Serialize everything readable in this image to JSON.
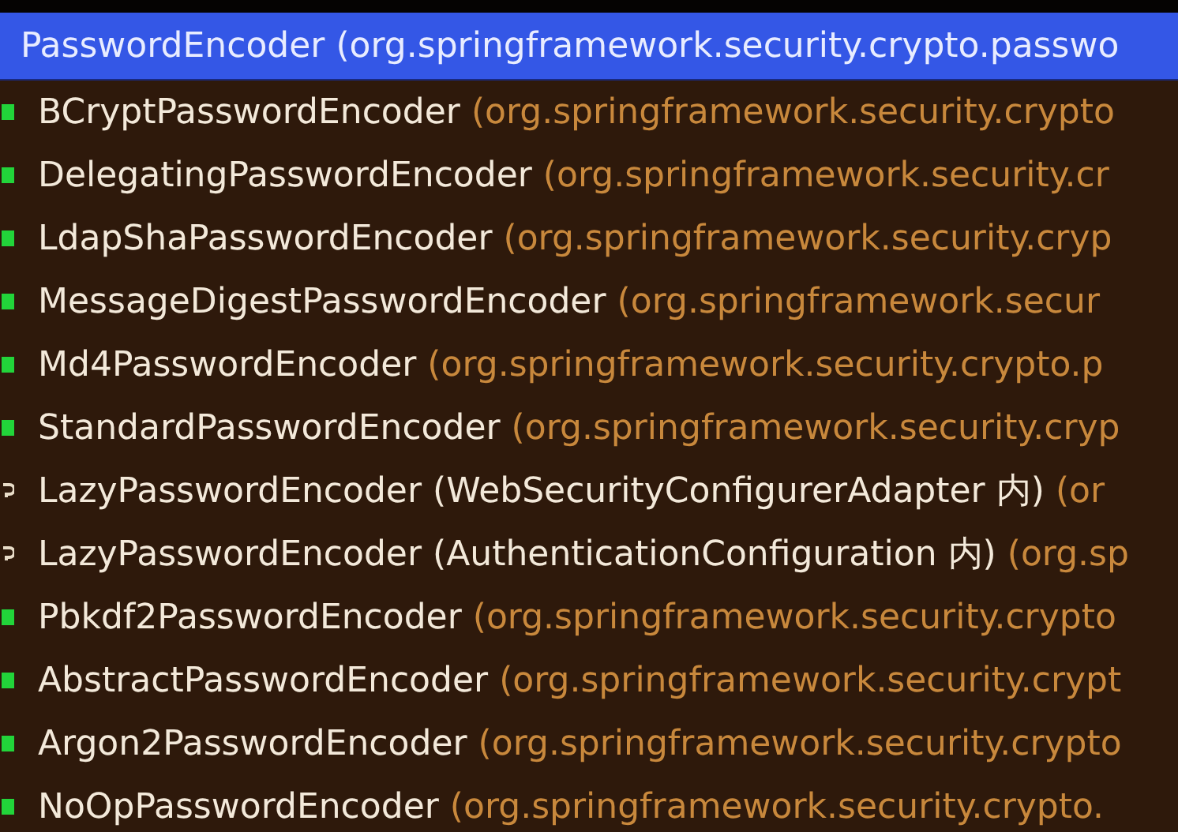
{
  "header": {
    "name": "PasswordEncoder",
    "detail": "(org.springframework.security.crypto.passwo"
  },
  "items": [
    {
      "kind": "class",
      "name": "BCryptPasswordEncoder",
      "detail": "(org.springframework.security.crypto"
    },
    {
      "kind": "class",
      "name": "DelegatingPasswordEncoder",
      "detail": "(org.springframework.security.cr"
    },
    {
      "kind": "class",
      "name": "LdapShaPasswordEncoder",
      "detail": "(org.springframework.security.cryp"
    },
    {
      "kind": "class",
      "name": "MessageDigestPasswordEncoder",
      "detail": "(org.springframework.secur"
    },
    {
      "kind": "class",
      "name": "Md4PasswordEncoder",
      "detail": "(org.springframework.security.crypto.p"
    },
    {
      "kind": "class",
      "name": "StandardPasswordEncoder",
      "detail": "(org.springframework.security.cryp"
    },
    {
      "kind": "inner",
      "name": "LazyPasswordEncoder",
      "outer": "(WebSecurityConfigurerAdapter 内)",
      "detail": "(or"
    },
    {
      "kind": "inner",
      "name": "LazyPasswordEncoder",
      "outer": "(AuthenticationConfiguration 内)",
      "detail": "(org.sp"
    },
    {
      "kind": "class",
      "name": "Pbkdf2PasswordEncoder",
      "detail": "(org.springframework.security.crypto"
    },
    {
      "kind": "class",
      "name": "AbstractPasswordEncoder",
      "detail": "(org.springframework.security.crypt"
    },
    {
      "kind": "class",
      "name": "Argon2PasswordEncoder",
      "detail": "(org.springframework.security.crypto"
    },
    {
      "kind": "class",
      "name": "NoOpPasswordEncoder",
      "detail": "(org.springframework.security.crypto."
    }
  ]
}
